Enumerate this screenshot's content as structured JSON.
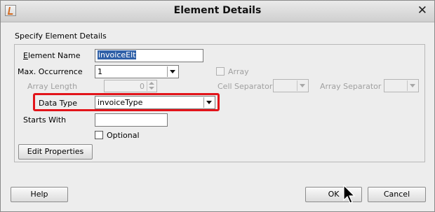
{
  "window": {
    "title": "Element Details",
    "icon": "java-cup-icon",
    "close_glyph": "✕"
  },
  "section": {
    "label": "Specify Element Details"
  },
  "form": {
    "element_name": {
      "label": "Element Name",
      "value": "invoiceElt"
    },
    "max_occurrence": {
      "label": "Max. Occurrence",
      "value": "1"
    },
    "array": {
      "label": "Array",
      "checked": false
    },
    "array_length": {
      "label": "Array Length",
      "value": "0"
    },
    "cell_separator": {
      "label": "Cell Separator",
      "value": ""
    },
    "array_separator": {
      "label": "Array Separator",
      "value": ""
    },
    "data_type": {
      "label": "Data Type",
      "value": "invoiceType"
    },
    "starts_with": {
      "label": "Starts With",
      "value": ""
    },
    "optional": {
      "label": "Optional",
      "checked": false
    },
    "edit_properties": {
      "label": "Edit Properties"
    }
  },
  "footer": {
    "help": "Help",
    "ok": "OK",
    "cancel": "Cancel"
  },
  "colors": {
    "highlight": "#e2141a",
    "selection": "#2f60a8"
  }
}
